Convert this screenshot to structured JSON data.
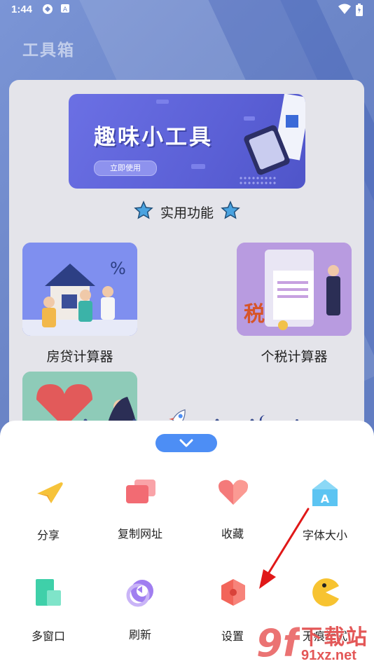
{
  "status_bar": {
    "time": "1:44"
  },
  "page": {
    "title": "工具箱"
  },
  "banner": {
    "title": "趣味小工具",
    "button": "立即使用"
  },
  "section": {
    "title": "实用功能"
  },
  "tools": [
    {
      "label": "房贷计算器"
    },
    {
      "label": "个税计算器"
    }
  ],
  "bottom_sheet": {
    "items": [
      {
        "label": "分享",
        "icon": "airplane-icon"
      },
      {
        "label": "复制网址",
        "icon": "copy-icon"
      },
      {
        "label": "收藏",
        "icon": "heart-icon"
      },
      {
        "label": "字体大小",
        "icon": "font-size-icon"
      },
      {
        "label": "多窗口",
        "icon": "multi-window-icon"
      },
      {
        "label": "刷新",
        "icon": "refresh-icon"
      },
      {
        "label": "设置",
        "icon": "settings-icon"
      },
      {
        "label": "无痕模式",
        "icon": "incognito-icon"
      }
    ]
  },
  "watermark": {
    "brand": "下载站",
    "domain": "91xz.net",
    "logo": "9f"
  },
  "colors": {
    "accent": "#4d8ef5",
    "banner": "#5b60d6",
    "annotation": "#e01818"
  }
}
